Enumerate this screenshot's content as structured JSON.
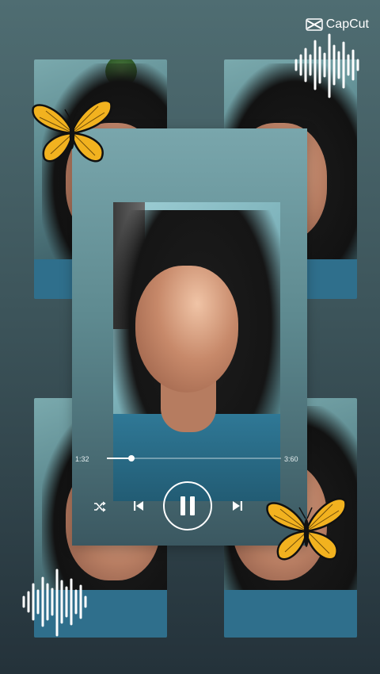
{
  "brand": {
    "name": "CapCut"
  },
  "player": {
    "elapsed": "1:32",
    "total": "3:60",
    "progress_fraction": 0.14,
    "icons": [
      "shuffle-icon",
      "previous-icon",
      "pause-icon",
      "next-icon"
    ]
  },
  "decor": {
    "accent": "#f2b21f",
    "background": "#3d555b"
  }
}
